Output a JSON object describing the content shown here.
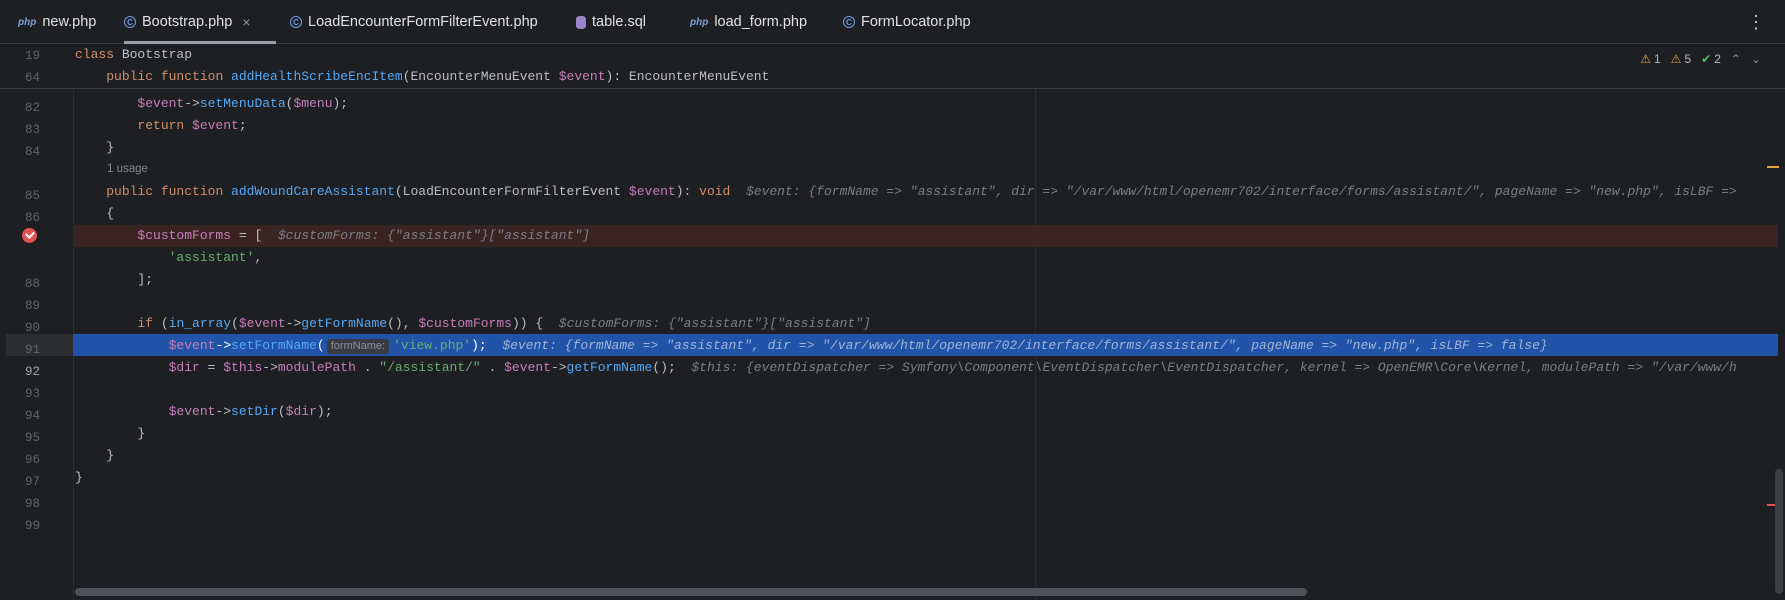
{
  "tabs": [
    {
      "label": "new.php",
      "icon": "php-file-icon",
      "active": false
    },
    {
      "label": "Bootstrap.php",
      "icon": "php-class-icon",
      "active": true
    },
    {
      "label": "LoadEncounterFormFilterEvent.php",
      "icon": "php-class-icon",
      "active": false
    },
    {
      "label": "table.sql",
      "icon": "database-file-icon",
      "active": false
    },
    {
      "label": "load_form.php",
      "icon": "php-file-icon",
      "active": false
    },
    {
      "label": "FormLocator.php",
      "icon": "php-class-icon",
      "active": false
    }
  ],
  "tab_close": "×",
  "php_glyph": "php",
  "class_glyph": "C",
  "menu_glyph": "⋮",
  "inspections": {
    "warnings": "1",
    "weak_warnings": "5",
    "typos": "2",
    "up": "⌃",
    "down": "⌄"
  },
  "sticky": {
    "line1_num": "19",
    "line1_kw": "class",
    "line1_name": " Bootstrap",
    "line2_num": "64",
    "line2_a": "    ",
    "line2_kw1": "public",
    "line2_kw2": " function ",
    "line2_fn": "addHealthScribeEncItem",
    "line2_b": "(EncounterMenuEvent ",
    "line2_var": "$event",
    "line2_c": "): EncounterMenuEvent"
  },
  "usage_hint": "1 usage",
  "line_numbers": [
    "82",
    "83",
    "84",
    "85",
    "86",
    "87",
    "88",
    "89",
    "90",
    "91",
    "92",
    "93",
    "94",
    "95",
    "96",
    "97",
    "98",
    "99"
  ],
  "code": {
    "l82": {
      "a": "        ",
      "v": "$event",
      "b": "->",
      "f": "setMenuData",
      "c": "(",
      "v2": "$menu",
      "d": ");"
    },
    "l83": {
      "a": "        ",
      "k": "return ",
      "v": "$event",
      "b": ";"
    },
    "l84": {
      "a": "    }"
    },
    "l85": {
      "a": "    ",
      "k1": "public",
      "k2": " function ",
      "f": "addWoundCareAssistant",
      "b": "(LoadEncounterFormFilterEvent ",
      "v": "$event",
      "c": "): ",
      "k3": "void",
      "hint": "  $event: {formName => \"assistant\", dir => \"/var/www/html/openemr702/interface/forms/assistant/\", pageName => \"new.php\", isLBF =>"
    },
    "l86": {
      "a": "    {"
    },
    "l87": {
      "a": "        ",
      "v": "$customForms",
      "b": " = [",
      "hint": "  $customForms: {\"assistant\"}[\"assistant\"]"
    },
    "l88": {
      "a": "            ",
      "s": "'assistant'",
      "b": ","
    },
    "l89": {
      "a": "        ];"
    },
    "l91": {
      "a": "        ",
      "k": "if ",
      "b": "(",
      "f": "in_array",
      "c": "(",
      "v": "$event",
      "d": "->",
      "f2": "getFormName",
      "e": "(), ",
      "v2": "$customForms",
      "g": ")) {",
      "hint": "  $customForms: {\"assistant\"}[\"assistant\"]"
    },
    "l92": {
      "a": "            ",
      "v": "$event",
      "b": "->",
      "f": "setFormName",
      "c": "(",
      "inlay": "formName:",
      "s": "'view.php'",
      "d": ");",
      "hint": "  $event: {formName => \"assistant\", dir => \"/var/www/html/openemr702/interface/forms/assistant/\", pageName => \"new.php\", isLBF => false}"
    },
    "l93": {
      "a": "            ",
      "v": "$dir",
      "b": " = ",
      "v2": "$this",
      "c": "->",
      "p": "modulePath",
      "d": " . ",
      "s": "\"/assistant/\"",
      "e": " . ",
      "v3": "$event",
      "g": "->",
      "f": "getFormName",
      "h": "();",
      "hint": "  $this: {eventDispatcher => Symfony\\Component\\EventDispatcher\\EventDispatcher, kernel => OpenEMR\\Core\\Kernel, modulePath => \"/var/www/h"
    },
    "l95": {
      "a": "            ",
      "v": "$event",
      "b": "->",
      "f": "setDir",
      "c": "(",
      "v2": "$dir",
      "d": ");"
    },
    "l96": {
      "a": "        }"
    },
    "l97": {
      "a": "    }"
    },
    "l98": {
      "a": "}"
    }
  },
  "colors": {
    "breakpoint": "#e35252",
    "execution_line": "#2154a8",
    "warning": "#e8a33d"
  }
}
